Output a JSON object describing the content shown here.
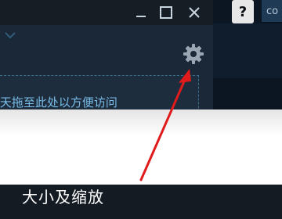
{
  "header": {
    "help_label": "?",
    "tab_partial_label": "co"
  },
  "drop_zone": {
    "text": "]天拖至此处以方便访问"
  },
  "menu": {
    "item_size_and_zoom": "大小及缩放"
  },
  "icons": {
    "dropdown": "chevron-down-icon",
    "minimize": "minimize-icon",
    "maximize": "maximize-icon",
    "close": "close-icon",
    "settings": "gear-icon",
    "annotation": "red-arrow-icon"
  },
  "colors": {
    "arrow": "#e01b1b",
    "text_link": "#79bde8"
  }
}
